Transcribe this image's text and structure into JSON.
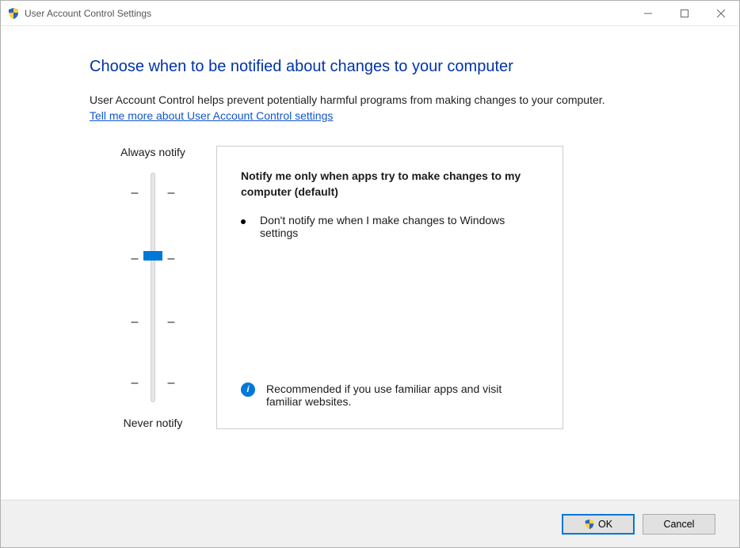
{
  "window": {
    "title": "User Account Control Settings"
  },
  "heading": "Choose when to be notified about changes to your computer",
  "intro": "User Account Control helps prevent potentially harmful programs from making changes to your computer.",
  "link_label": "Tell me more about User Account Control settings",
  "slider": {
    "top_label": "Always notify",
    "bottom_label": "Never notify",
    "levels": 4,
    "selected_index": 1
  },
  "panel": {
    "title": "Notify me only when apps try to make changes to my computer (default)",
    "bullet_text": "Don't notify me when I make changes to Windows settings",
    "note_text": "Recommended if you use familiar apps and visit familiar websites."
  },
  "buttons": {
    "ok": "OK",
    "cancel": "Cancel"
  }
}
